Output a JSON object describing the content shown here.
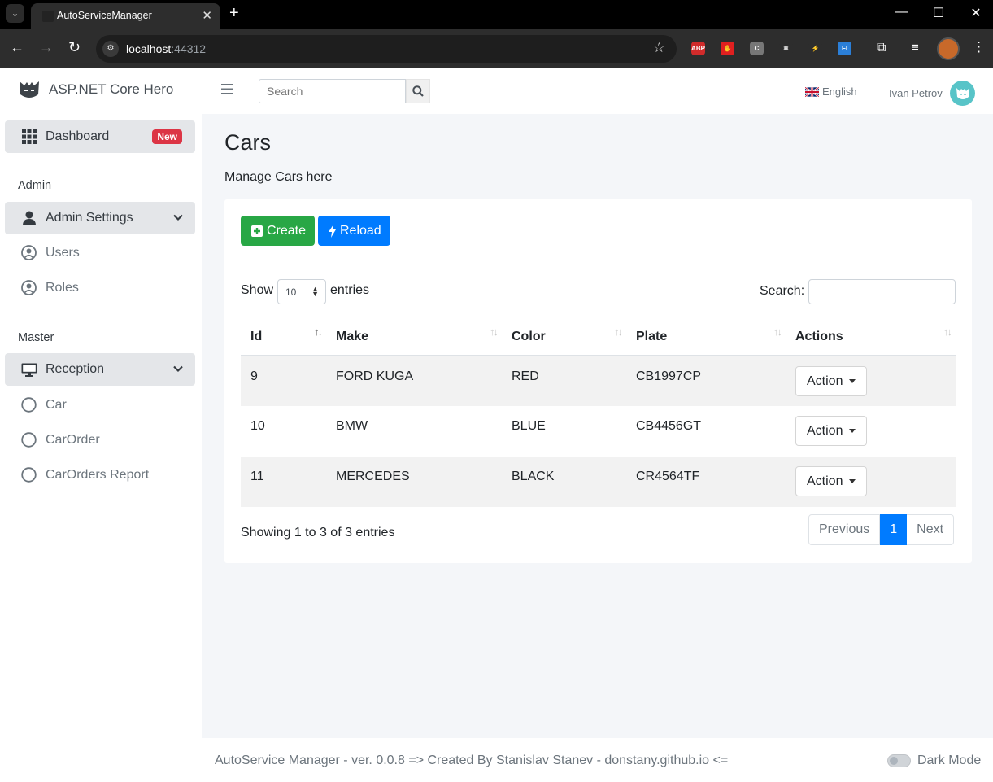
{
  "browser": {
    "tab_title": "AutoServiceManager",
    "url_host": "localhost",
    "url_port": ":44312",
    "extensions": [
      {
        "name": "abp-icon",
        "label": "ABP",
        "color": "#d12b2b"
      },
      {
        "name": "hand-stop-icon",
        "label": "✋",
        "color": "#e02020"
      },
      {
        "name": "c-extension-icon",
        "label": "C",
        "color": "#777777"
      },
      {
        "name": "react-devtools-icon",
        "label": "⚛",
        "color": "#2d2d2d"
      },
      {
        "name": "lightning-extension-icon",
        "label": "⚡",
        "color": "#2d2d2d"
      },
      {
        "name": "fi-extension-icon",
        "label": "FI",
        "color": "#2b7fd8"
      }
    ]
  },
  "sidebar": {
    "brand": "ASP.NET Core Hero",
    "dashboard": {
      "label": "Dashboard",
      "badge": "New"
    },
    "admin_header": "Admin",
    "admin_settings": "Admin Settings",
    "admin_items": [
      "Users",
      "Roles"
    ],
    "master_header": "Master",
    "reception": "Reception",
    "reception_items": [
      "Car",
      "CarOrder",
      "CarOrders Report"
    ]
  },
  "topbar": {
    "search_placeholder": "Search",
    "language": "English",
    "user_name": "Ivan Petrov"
  },
  "page": {
    "title": "Cars",
    "subtitle": "Manage Cars here",
    "create_label": "Create",
    "reload_label": "Reload"
  },
  "datatable": {
    "show_label": "Show",
    "page_length": "10",
    "entries_label": "entries",
    "search_label": "Search:",
    "columns": [
      "Id",
      "Make",
      "Color",
      "Plate",
      "Actions"
    ],
    "rows": [
      {
        "id": "9",
        "make": "FORD KUGA",
        "color": "RED",
        "plate": "CB1997CP",
        "action": "Action"
      },
      {
        "id": "10",
        "make": "BMW",
        "color": "BLUE",
        "plate": "CB4456GT",
        "action": "Action"
      },
      {
        "id": "11",
        "make": "MERCEDES",
        "color": "BLACK",
        "plate": "CR4564TF",
        "action": "Action"
      }
    ],
    "info": "Showing 1 to 3 of 3 entries",
    "pagination": {
      "previous": "Previous",
      "current": "1",
      "next": "Next"
    }
  },
  "footer": {
    "text": "AutoService Manager - ver. 0.0.8 => Created By Stanislav Stanev - donstany.github.io <=",
    "dark_mode_label": "Dark Mode"
  },
  "colors": {
    "success": "#28a745",
    "primary": "#007bff",
    "danger": "#dc3545"
  }
}
